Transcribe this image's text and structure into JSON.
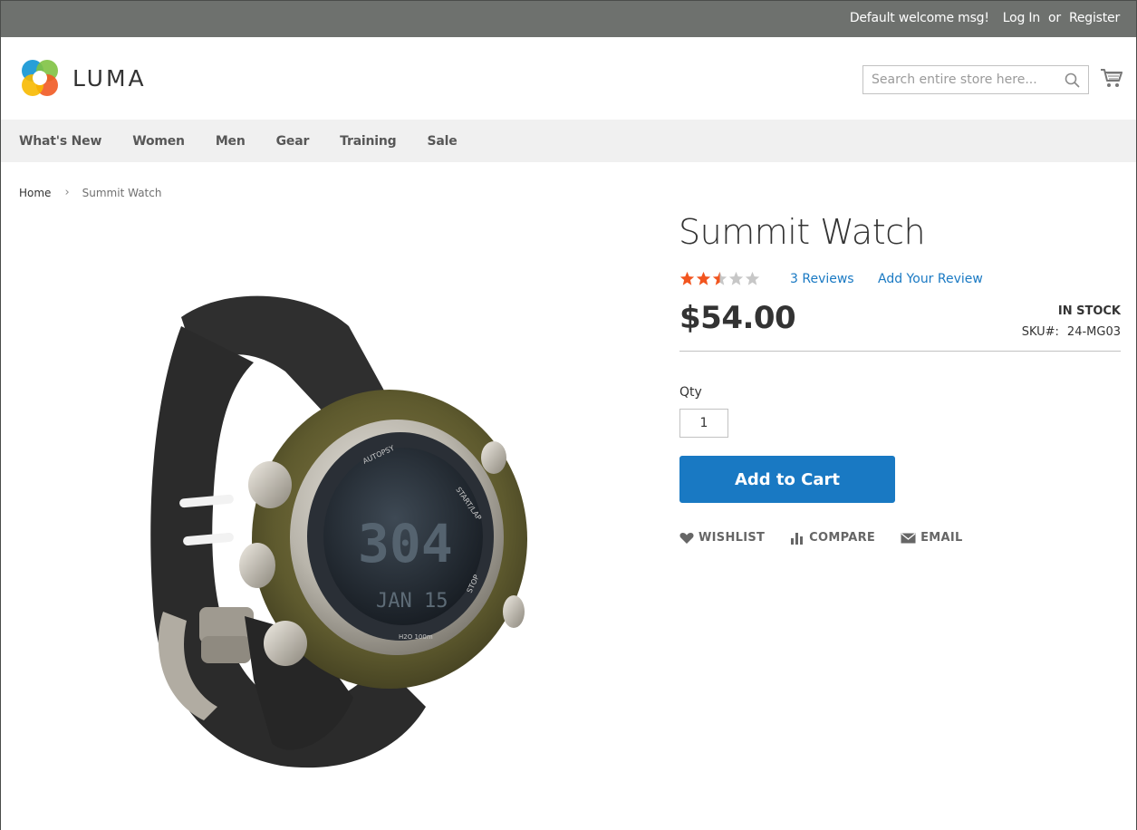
{
  "panel": {
    "welcome": "Default welcome msg!",
    "login": "Log In",
    "or": "or",
    "register": "Register"
  },
  "header": {
    "logo_text": "LUMA",
    "search_placeholder": "Search entire store here...",
    "icons": [
      "search-icon",
      "cart-icon"
    ]
  },
  "nav": {
    "items": [
      "What's New",
      "Women",
      "Men",
      "Gear",
      "Training",
      "Sale"
    ]
  },
  "breadcrumb": {
    "home": "Home",
    "separator": "›",
    "current": "Summit Watch"
  },
  "product": {
    "title": "Summit Watch",
    "rating": 2.5,
    "rating_max": 5,
    "reviews_label": "3 Reviews",
    "add_review_label": "Add Your Review",
    "price": "$54.00",
    "stock": "IN STOCK",
    "sku_label": "SKU#:",
    "sku_value": "24-MG03",
    "qty_label": "Qty",
    "qty_value": "1",
    "add_to_cart": "Add to Cart",
    "actions": {
      "wishlist": "WISHLIST",
      "compare": "COMPARE",
      "email": "EMAIL"
    }
  },
  "colors": {
    "panel_bg": "#6e716e",
    "nav_bg": "#f0f0f0",
    "primary": "#1979c3",
    "star_on": "#f2551f",
    "star_off": "#c7c7c7"
  }
}
